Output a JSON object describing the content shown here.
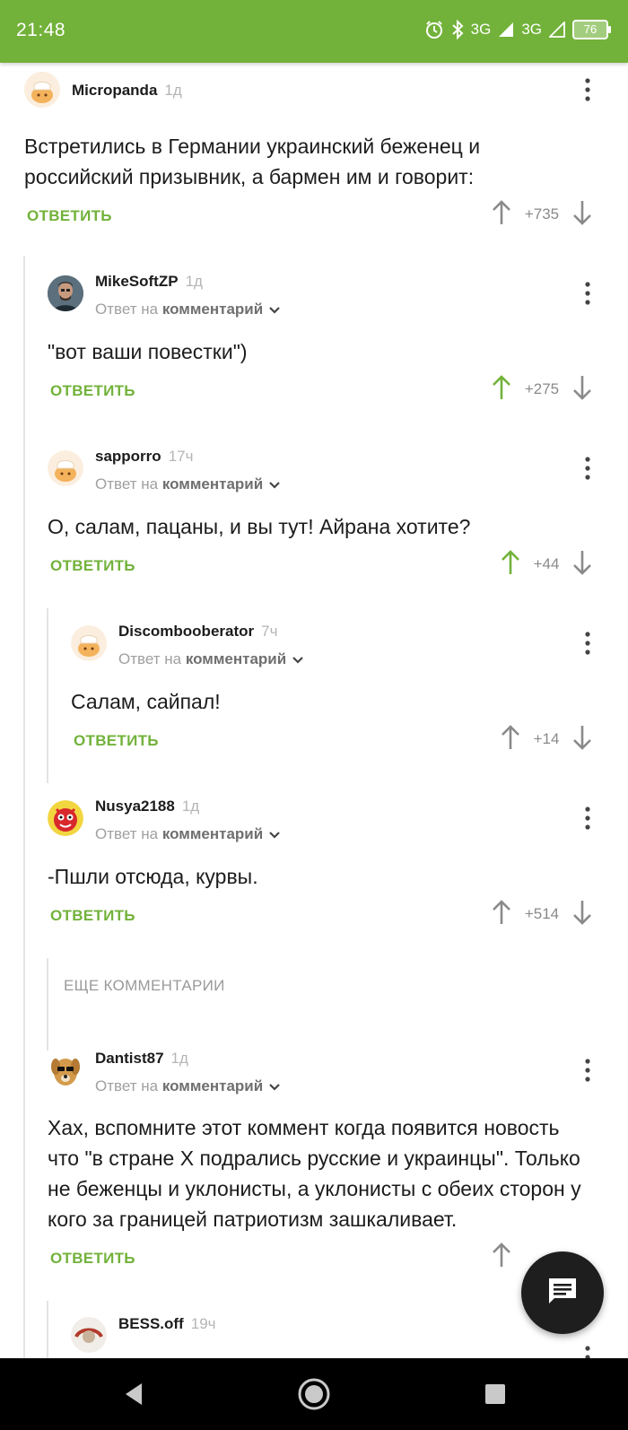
{
  "status_bar": {
    "time": "21:48",
    "net1": "3G",
    "net2": "3G",
    "battery": "76"
  },
  "comments": [
    {
      "author": "Micropanda",
      "age": "1д",
      "text_lines": [
        "Встретились в Германии украинский беженец и",
        "российский призывник, а бармен им и говорит:"
      ],
      "reply_label": "ОТВЕТИТЬ",
      "score": "+735"
    },
    {
      "author": "MikeSoftZP",
      "age": "1д",
      "reply_to_prefix": "Ответ на",
      "reply_to_target": "комментарий",
      "text_lines": [
        "\"вот ваши повестки\")"
      ],
      "reply_label": "ОТВЕТИТЬ",
      "score": "+275"
    },
    {
      "author": "sapporro",
      "age": "17ч",
      "reply_to_prefix": "Ответ на",
      "reply_to_target": "комментарий",
      "text_lines": [
        "О, салам, пацаны, и вы тут! Айрана хотите?"
      ],
      "reply_label": "ОТВЕТИТЬ",
      "score": "+44"
    },
    {
      "author": "Discombooberator",
      "age": "7ч",
      "reply_to_prefix": "Ответ на",
      "reply_to_target": "комментарий",
      "text_lines": [
        "Салам, сайпал!"
      ],
      "reply_label": "ОТВЕТИТЬ",
      "score": "+14"
    },
    {
      "author": "Nusya2188",
      "age": "1д",
      "reply_to_prefix": "Ответ на",
      "reply_to_target": "комментарий",
      "text_lines": [
        "-Пшли отсюда, курвы."
      ],
      "reply_label": "ОТВЕТИТЬ",
      "score": "+514"
    },
    {
      "author": "Dantist87",
      "age": "1д",
      "reply_to_prefix": "Ответ на",
      "reply_to_target": "комментарий",
      "text_lines": [
        "Хах, вспомните этот коммент когда появится новость",
        "что \"в стране Х подрались русские и украинцы\". Только",
        "не беженцы и уклонисты, а уклонисты с обеих сторон у",
        "кого за границей патриотизм зашкаливает."
      ],
      "reply_label": "ОТВЕТИТЬ"
    },
    {
      "author": "BESS.off",
      "age": "19ч"
    }
  ],
  "more_comments_label": "ЕЩЕ КОММЕНТАРИИ",
  "colors": {
    "accent": "#72b23a",
    "upvote_active": "#72b23a",
    "neutral": "#8a8a8a"
  },
  "icons": {
    "upvote": "arrow-up-icon",
    "downvote": "arrow-down-icon",
    "menu": "more-vertical-icon",
    "fab": "comment-icon",
    "nav_back": "back-icon",
    "nav_home": "home-icon",
    "nav_recent": "recent-apps-icon"
  }
}
